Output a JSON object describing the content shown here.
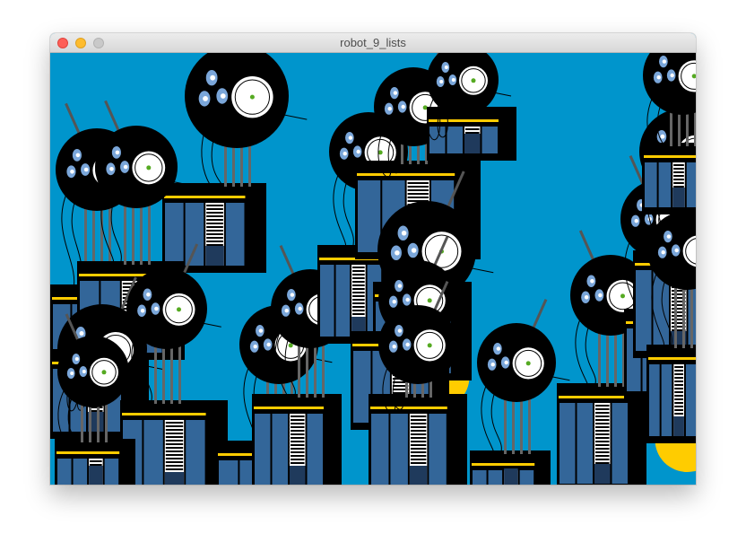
{
  "window": {
    "title": "robot_9_lists",
    "controls": {
      "close": "close-button",
      "minimize": "minimize-button",
      "zoom": "zoom-button"
    }
  },
  "sketch": {
    "background": "#0095cc",
    "colors": {
      "body_dark": "#000000",
      "panel_blue": "#336699",
      "panel_dark": "#1f3a5c",
      "stripe_yellow": "#ffcc00",
      "stripe_white": "#ffffff",
      "eye_white": "#ffffff",
      "pupil_green": "#55aa22",
      "small_eye_blue": "#7aa6d9",
      "neck_gray": "#666666",
      "antenna_gray": "#555555"
    },
    "robot_count": 26
  }
}
